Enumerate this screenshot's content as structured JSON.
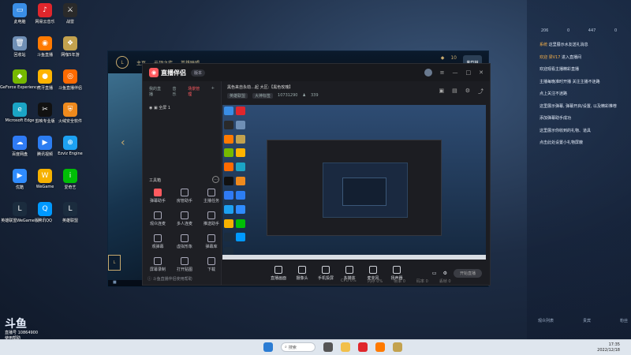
{
  "desktop_icons": [
    {
      "label": "此电脑",
      "color": "#3a8ee6",
      "glyph": "▭"
    },
    {
      "label": "网易云音乐",
      "color": "#e0262c",
      "glyph": "♪"
    },
    {
      "label": "战雷",
      "color": "#2a2a2a",
      "glyph": "⚔"
    },
    {
      "label": "回收站",
      "color": "#6f8fb5",
      "glyph": "🗑"
    },
    {
      "label": "斗鱼直播",
      "color": "#ff7a00",
      "glyph": "◉"
    },
    {
      "label": "网咖5年游",
      "color": "#c3a24e",
      "glyph": "❖"
    },
    {
      "label": "GeForce Experience",
      "color": "#76b900",
      "glyph": "◆"
    },
    {
      "label": "虎牙直播",
      "color": "#ffb400",
      "glyph": "●"
    },
    {
      "label": "斗鱼直播伴侣",
      "color": "#ff6a00",
      "glyph": "◎"
    },
    {
      "label": "Microsoft Edge",
      "color": "#1ba4c5",
      "glyph": "e"
    },
    {
      "label": "剪映专业版",
      "color": "#111",
      "glyph": "✂"
    },
    {
      "label": "火绒安全软件",
      "color": "#ef8a1d",
      "glyph": "⛨"
    },
    {
      "label": "百度网盘",
      "color": "#2f7bf5",
      "glyph": "☁"
    },
    {
      "label": "腾讯视频",
      "color": "#2c7df2",
      "glyph": "▶"
    },
    {
      "label": "Ezviz Engine",
      "color": "#1da1f2",
      "glyph": "⊕"
    },
    {
      "label": "优酷",
      "color": "#2f8cff",
      "glyph": "▶"
    },
    {
      "label": "WeGame",
      "color": "#f6b100",
      "glyph": "W"
    },
    {
      "label": "爱奇艺",
      "color": "#00be06",
      "glyph": "i"
    },
    {
      "label": "英雄联盟WeGame版",
      "color": "#1b2c3e",
      "glyph": "L"
    },
    {
      "label": "腾讯QQ",
      "color": "#0099ff",
      "glyph": "Q"
    },
    {
      "label": "英雄联盟",
      "color": "#1b2c3e",
      "glyph": "L"
    }
  ],
  "game": {
    "tabs": [
      "主页",
      "云顶之弈",
      "英雄联盟"
    ],
    "currency": "10",
    "avatar_label": "紫竹林",
    "level": "L"
  },
  "app": {
    "brand": "直播伴侣",
    "version": "版本",
    "side_tabs": [
      "我的直播",
      "音乐",
      "场景管理"
    ],
    "scene": "全屏 1",
    "tools_label": "工具箱",
    "tools": [
      {
        "label": "弹幕助手",
        "red": true
      },
      {
        "label": "房管助手",
        "red": false
      },
      {
        "label": "主播任务",
        "red": false
      },
      {
        "label": "观众连麦",
        "red": false
      },
      {
        "label": "多人连麦",
        "red": false
      },
      {
        "label": "推送助手",
        "red": false
      },
      {
        "label": "观弹幕",
        "red": false
      },
      {
        "label": "虚拟形象",
        "red": false
      },
      {
        "label": "弹幕库",
        "red": false
      },
      {
        "label": "屏幕录制",
        "red": false
      },
      {
        "label": "打开贴图",
        "red": false
      },
      {
        "label": "下载",
        "red": false
      }
    ],
    "tip": "斗鱼直播伴侣使用帮助",
    "room_title": "黑色来自永劫…起  大区:【黑色玫瑰】",
    "chips": [
      "英雄联盟",
      "大神标签"
    ],
    "room_id": "10731290",
    "viewer_count": "339",
    "controls": [
      "直播画面",
      "摄像头",
      "手机投屏",
      "多媒体",
      "麦克风",
      "扬声器"
    ],
    "start_button": "开始直播",
    "stats": [
      "CPU 0%",
      "内存 0%",
      "帧率 0",
      "码率 0",
      "丢帧 0"
    ]
  },
  "chat": {
    "top": [
      "206",
      "0",
      "447",
      "0"
    ],
    "messages": [
      {
        "user": "系统",
        "text": "这里展示水友送礼消息"
      },
      {
        "user": "欢迎 梁V17",
        "text": "进入直播间"
      },
      {
        "user": "",
        "text": "欢迎观看主播精彩直播"
      },
      {
        "user": "",
        "text": "主播每晚准时开播 关注主播不迷路"
      },
      {
        "user": "",
        "text": "点上关注不迷路"
      },
      {
        "user": "",
        "text": "这里展示弹幕, 弹幕开启/设置, 以及精彩推荐"
      },
      {
        "user": "",
        "text": "添加弹幕助手成功"
      },
      {
        "user": "",
        "text": "这里展示你收到的礼物、道具"
      },
      {
        "user": "",
        "text": "点击此处设置小礼物屏蔽"
      }
    ],
    "foot": [
      "观众列表",
      "贵宾",
      "粉丝"
    ]
  },
  "taskbar": {
    "search": "搜索",
    "time": "17:35",
    "date": "2022/12/18"
  },
  "weather": {
    "temp": "斗鱼",
    "sub": "直播号 10864900",
    "hint": "使用帮助"
  }
}
